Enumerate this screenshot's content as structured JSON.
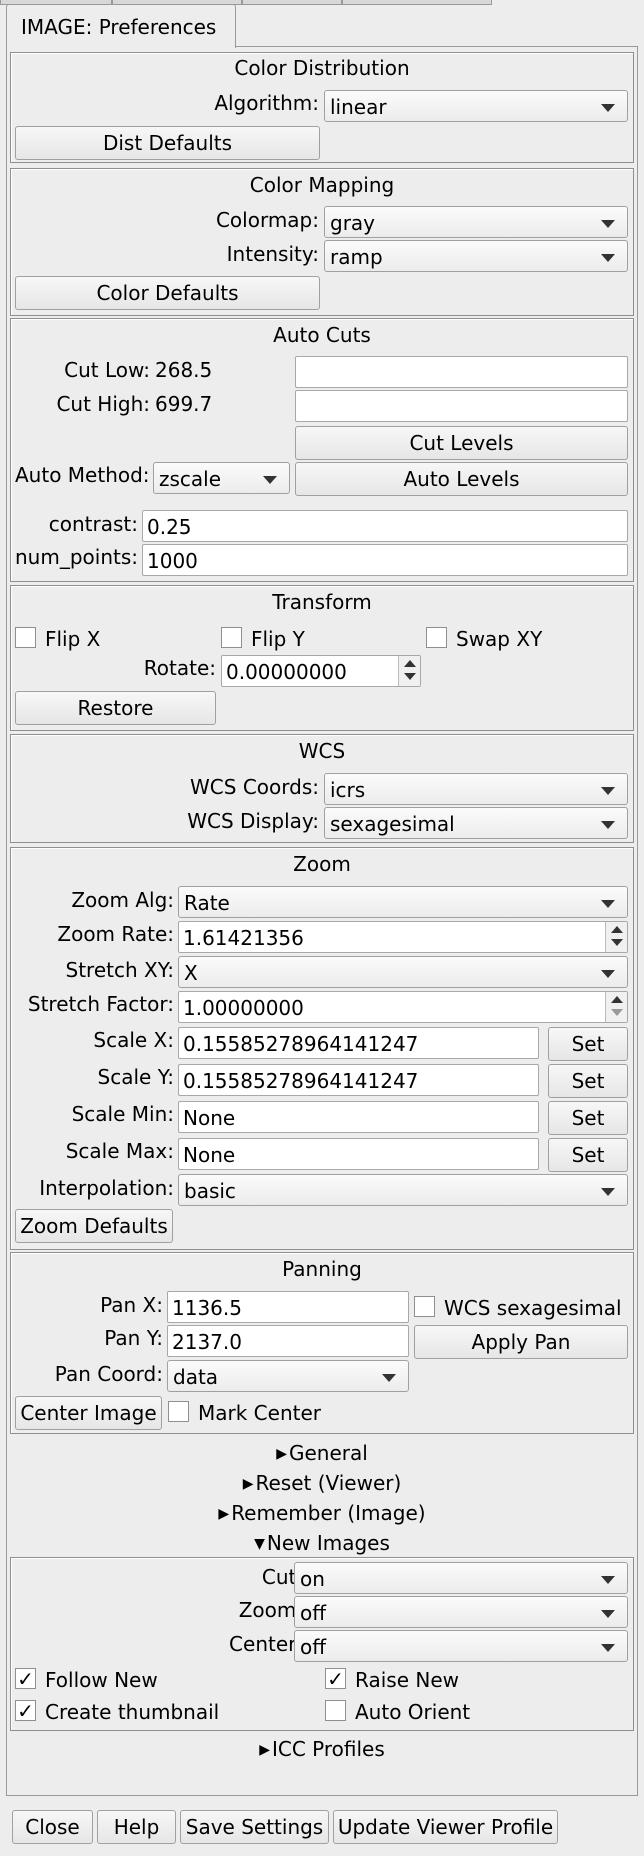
{
  "tab": {
    "title": "IMAGE: Preferences"
  },
  "color_dist": {
    "title": "Color Distribution",
    "algorithm_label": "Algorithm:",
    "algorithm": "linear",
    "defaults": "Dist Defaults"
  },
  "color_map": {
    "title": "Color Mapping",
    "colormap_label": "Colormap:",
    "colormap": "gray",
    "intensity_label": "Intensity:",
    "intensity": "ramp",
    "defaults": "Color Defaults"
  },
  "auto_cuts": {
    "title": "Auto Cuts",
    "cut_low_label": "Cut Low:",
    "cut_low": "268.5",
    "cut_high_label": "Cut High:",
    "cut_high": "699.7",
    "cut_levels": "Cut Levels",
    "auto_method_label": "Auto Method:",
    "auto_method": "zscale",
    "auto_levels": "Auto Levels",
    "contrast_label": "contrast:",
    "contrast": "0.25",
    "num_points_label": "num_points:",
    "num_points": "1000"
  },
  "transform": {
    "title": "Transform",
    "flip_x": "Flip X",
    "flip_y": "Flip Y",
    "swap_xy": "Swap XY",
    "rotate_label": "Rotate:",
    "rotate": "0.00000000",
    "restore": "Restore"
  },
  "wcs": {
    "title": "WCS",
    "coords_label": "WCS Coords:",
    "coords": "icrs",
    "display_label": "WCS Display:",
    "display": "sexagesimal"
  },
  "zoom": {
    "title": "Zoom",
    "alg_label": "Zoom Alg:",
    "alg": "Rate",
    "rate_label": "Zoom Rate:",
    "rate": "1.61421356",
    "stretch_xy_label": "Stretch XY:",
    "stretch_xy": "X",
    "stretch_factor_label": "Stretch Factor:",
    "stretch_factor": "1.00000000",
    "scale_x_label": "Scale X:",
    "scale_x": "0.15585278964141247",
    "scale_y_label": "Scale Y:",
    "scale_y": "0.15585278964141247",
    "scale_min_label": "Scale Min:",
    "scale_min": "None",
    "scale_max_label": "Scale Max:",
    "scale_max": "None",
    "set": "Set",
    "interp_label": "Interpolation:",
    "interp": "basic",
    "defaults": "Zoom Defaults"
  },
  "panning": {
    "title": "Panning",
    "pan_x_label": "Pan X:",
    "pan_x": "1136.5",
    "wcs_sexagesimal": "WCS sexagesimal",
    "pan_y_label": "Pan Y:",
    "pan_y": "2137.0",
    "apply_pan": "Apply Pan",
    "pan_coord_label": "Pan Coord:",
    "pan_coord": "data",
    "center_image": "Center Image",
    "mark_center": "Mark Center"
  },
  "expanders": {
    "general": "General",
    "reset": "Reset (Viewer)",
    "remember": "Remember (Image)",
    "new_images": "New Images",
    "icc": "ICC Profiles"
  },
  "new_images": {
    "cut_new_label": "Cut New:",
    "cut_new": "on",
    "zoom_new_label": "Zoom New:",
    "zoom_new": "off",
    "center_new_label": "Center New:",
    "center_new": "off",
    "follow_new": "Follow New",
    "raise_new": "Raise New",
    "create_thumbnail": "Create thumbnail",
    "auto_orient": "Auto Orient",
    "check_mark": "✓"
  },
  "footer": {
    "close": "Close",
    "help": "Help",
    "save": "Save Settings",
    "update": "Update Viewer Profile"
  }
}
